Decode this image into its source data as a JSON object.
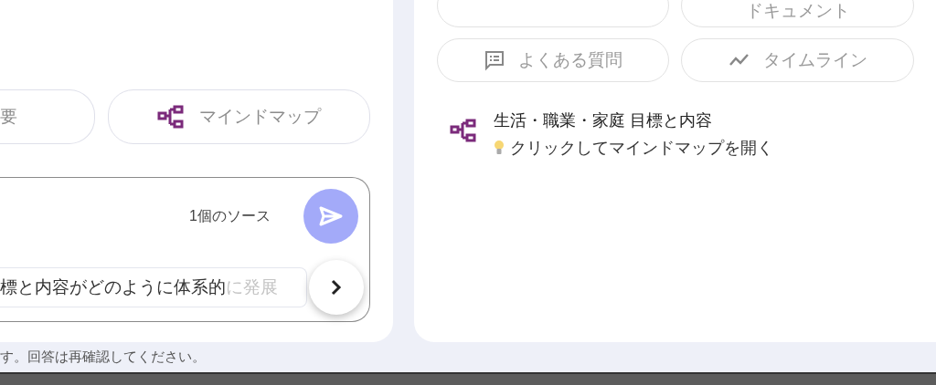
{
  "left_panel": {
    "output_buttons": [
      {
        "label": "要",
        "kind": "plain"
      },
      {
        "label": "マインドマップ",
        "kind": "mindmap"
      }
    ],
    "composer": {
      "source_count": "1個のソース",
      "send_disabled": true,
      "suggestion": {
        "text": "標と内容がどのように体系的",
        "faded_text": "に発展"
      }
    }
  },
  "right_panel": {
    "top_buttons": [
      {
        "kind": "guide"
      },
      {
        "label": "ドキュメント",
        "kind": "document"
      }
    ],
    "output_buttons": [
      {
        "label": "よくある質問",
        "kind": "faq"
      },
      {
        "label": "タイムライン",
        "kind": "timeline"
      }
    ],
    "notes": [
      {
        "title": "生活・職業・家庭 目標と内容",
        "hint": "クリックしてマインドマップを開く"
      }
    ]
  },
  "footer": "す。回答は再確認してください。"
}
